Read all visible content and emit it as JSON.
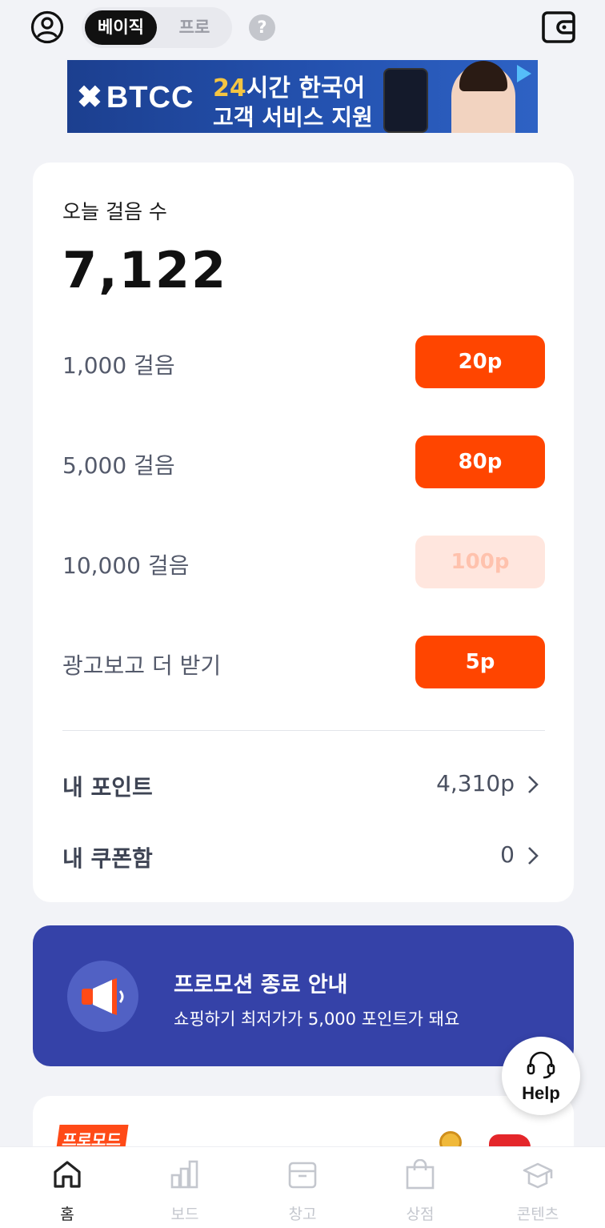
{
  "header": {
    "mode_toggle": {
      "active": "베이직",
      "inactive": "프로"
    },
    "help_glyph": "?",
    "icons": {
      "profile": "user-circle-icon",
      "wallet": "wallet-icon"
    }
  },
  "ad": {
    "brand": "BTCC",
    "line1_highlight": "24",
    "line1_rest": "시간 한국어",
    "line2": "고객 서비스 지원"
  },
  "steps": {
    "title": "오늘 걸음 수",
    "count": "7,122",
    "rewards": [
      {
        "label": "1,000 걸음",
        "points": "20p",
        "enabled": true
      },
      {
        "label": "5,000 걸음",
        "points": "80p",
        "enabled": true
      },
      {
        "label": "10,000 걸음",
        "points": "100p",
        "enabled": false
      },
      {
        "label": "광고보고 더 받기",
        "points": "5p",
        "enabled": true
      }
    ],
    "my_points": {
      "label": "내 포인트",
      "value": "4,310p"
    },
    "my_coupons": {
      "label": "내 쿠폰함",
      "value": "0"
    }
  },
  "promo": {
    "title": "프로모션 종료 안내",
    "subtitle": "쇼핑하기 최저가가 5,000 포인트가 돼요",
    "icon": "megaphone-icon"
  },
  "help_fab": {
    "label": "Help",
    "icon": "headset-icon"
  },
  "next_card": {
    "badge": "프로모드"
  },
  "nav": {
    "items": [
      {
        "label": "홈",
        "icon": "home-icon",
        "active": true
      },
      {
        "label": "보드",
        "icon": "bar-chart-icon",
        "active": false
      },
      {
        "label": "창고",
        "icon": "storage-box-icon",
        "active": false
      },
      {
        "label": "상점",
        "icon": "shopping-bag-icon",
        "active": false
      },
      {
        "label": "콘텐츠",
        "icon": "graduation-cap-icon",
        "active": false
      }
    ]
  },
  "colors": {
    "accent": "#ff4500",
    "accent_disabled_bg": "#ffe6de",
    "promo_bg": "#3542a8",
    "page_bg": "#f2f3f7"
  }
}
